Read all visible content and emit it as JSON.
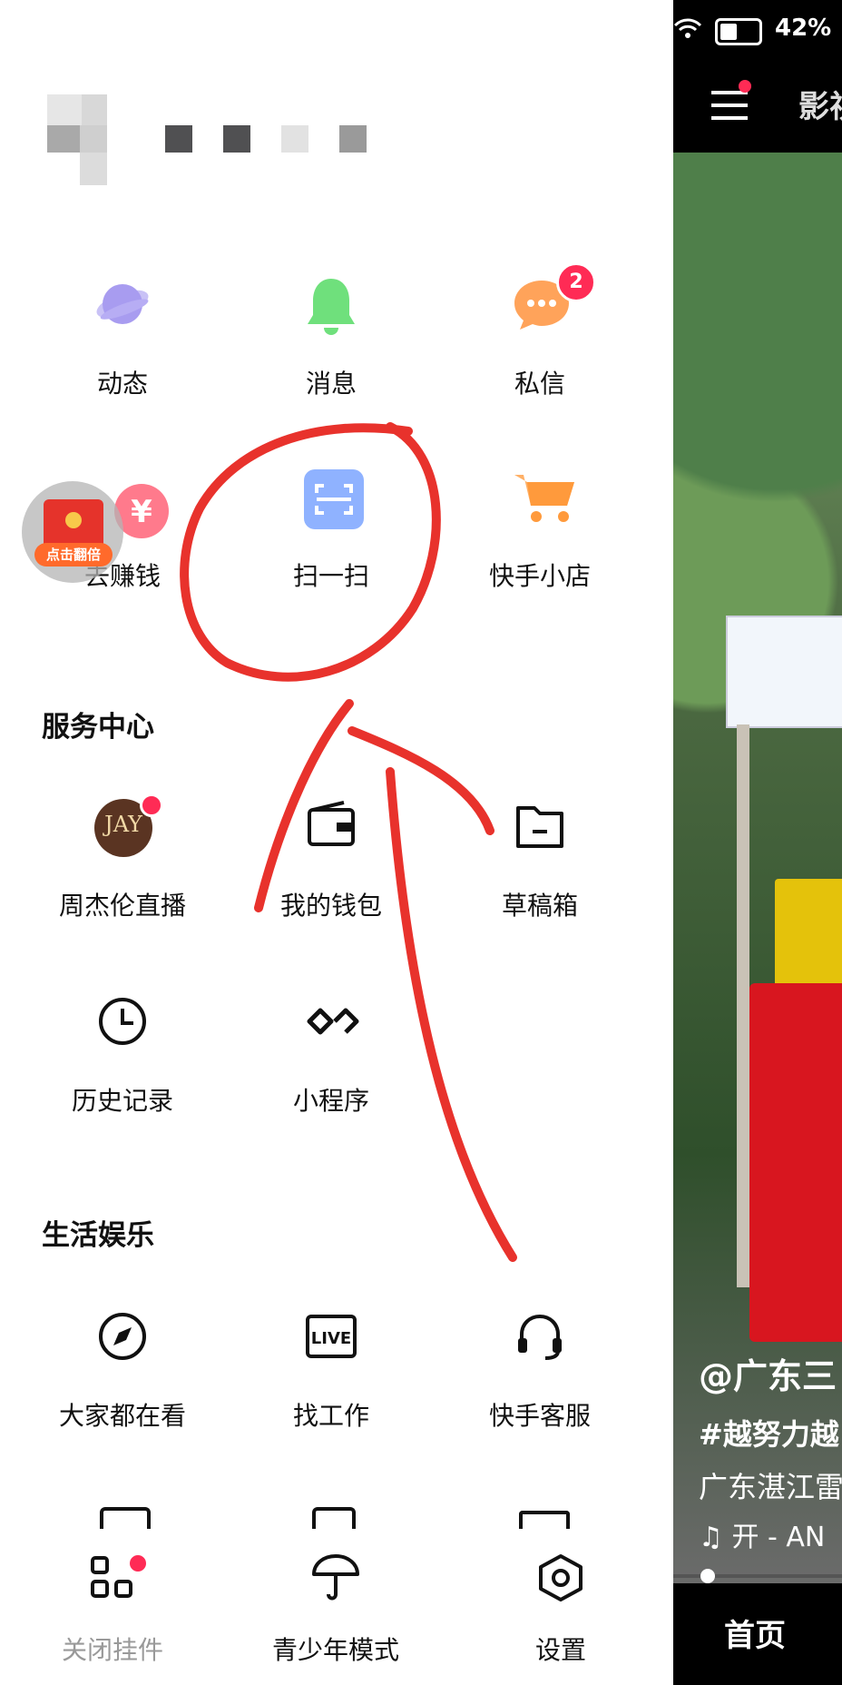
{
  "status": {
    "battery": "42%"
  },
  "grid_top": [
    {
      "label": "动态",
      "icon": "planet-icon"
    },
    {
      "label": "消息",
      "icon": "bell-icon"
    },
    {
      "label": "私信",
      "icon": "chat-bubble-icon",
      "badge": "2"
    },
    {
      "label": "去赚钱",
      "icon": "yen-icon"
    },
    {
      "label": "扫一扫",
      "icon": "scan-icon"
    },
    {
      "label": "快手小店",
      "icon": "cart-icon"
    }
  ],
  "floating_red_packet": {
    "label": "点击翻倍"
  },
  "service_center": {
    "title": "服务中心",
    "items": [
      {
        "label": "周杰伦直播",
        "icon": "jay-avatar-icon",
        "avatar_text": "JAY"
      },
      {
        "label": "我的钱包",
        "icon": "wallet-icon"
      },
      {
        "label": "草稿箱",
        "icon": "folder-icon"
      },
      {
        "label": "历史记录",
        "icon": "clock-icon"
      },
      {
        "label": "小程序",
        "icon": "mini-program-icon"
      }
    ]
  },
  "life_entertainment": {
    "title": "生活娱乐",
    "items": [
      {
        "label": "大家都在看",
        "icon": "compass-icon"
      },
      {
        "label": "找工作",
        "icon": "live-icon",
        "icon_text": "LIVE"
      },
      {
        "label": "快手客服",
        "icon": "headset-icon"
      }
    ]
  },
  "bottom_bar": [
    {
      "label": "关闭挂件",
      "icon": "widgets-icon"
    },
    {
      "label": "青少年模式",
      "icon": "umbrella-icon"
    },
    {
      "label": "设置",
      "icon": "hexagon-settings-icon"
    }
  ],
  "right_panel": {
    "top_title": "影视",
    "texts": [
      "@广东三",
      "#越努力越",
      "广东湛江雷",
      "开 - AN"
    ],
    "bottom_tab": "首页"
  },
  "colors": {
    "accent_red": "#ff2b55",
    "annotation_red": "#e8322c",
    "bell_green": "#6fe07c",
    "planet_purple": "#a89cf0",
    "chat_orange": "#ffa35a",
    "scan_blue": "#8fb2ff",
    "cart_orange": "#ff9a3c"
  }
}
